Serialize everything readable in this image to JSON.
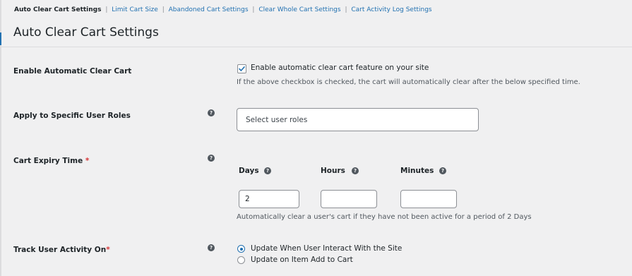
{
  "subnav": {
    "items": [
      {
        "label": "Auto Clear Cart Settings"
      },
      {
        "label": "Limit Cart Size"
      },
      {
        "label": "Abandoned Cart Settings"
      },
      {
        "label": "Clear Whole Cart Settings"
      },
      {
        "label": "Cart Activity Log Settings"
      }
    ],
    "separator": "|"
  },
  "page_title": "Auto Clear Cart Settings",
  "rows": {
    "enable": {
      "label": "Enable Automatic Clear Cart",
      "checkbox_label": "Enable automatic clear cart feature on your site",
      "checked": true,
      "description": "If the above checkbox is checked, the cart will automatically clear after the below specified time."
    },
    "roles": {
      "label": "Apply to Specific User Roles",
      "placeholder": "Select user roles"
    },
    "expiry": {
      "label": "Cart Expiry Time",
      "required_mark": "*",
      "days_label": "Days",
      "hours_label": "Hours",
      "minutes_label": "Minutes",
      "days_value": "2",
      "hours_value": "",
      "minutes_value": "",
      "description": "Automatically clear a user's cart if they have not been active for a period of 2 Days"
    },
    "track": {
      "label": "Track User Activity On",
      "required_mark": "*",
      "options": [
        {
          "label": "Update When User Interact With the Site",
          "selected": true
        },
        {
          "label": "Update on Item Add to Cart",
          "selected": false
        }
      ]
    }
  },
  "icons": {
    "help": "help-question-icon",
    "check": "checkmark-icon"
  },
  "colors": {
    "accent": "#2271b1",
    "required": "#d63638",
    "background": "#f0f0f1"
  }
}
